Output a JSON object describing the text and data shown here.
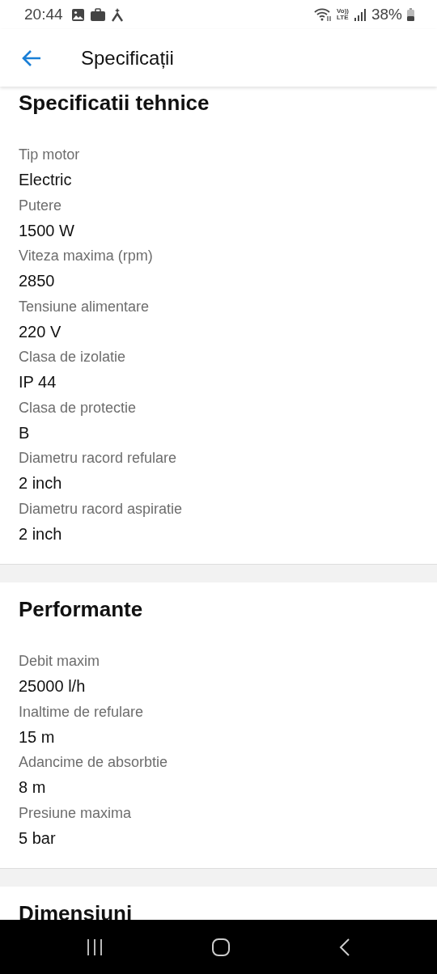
{
  "status_bar": {
    "time": "20:44",
    "network": "Vo)) LTE",
    "battery": "38%"
  },
  "app_bar": {
    "title": "Specificații"
  },
  "sections": [
    {
      "title": "Specificatii tehnice",
      "specs": [
        {
          "label": "Tip motor",
          "value": "Electric"
        },
        {
          "label": "Putere",
          "value": "1500 W"
        },
        {
          "label": "Viteza maxima (rpm)",
          "value": "2850"
        },
        {
          "label": "Tensiune alimentare",
          "value": "220 V"
        },
        {
          "label": "Clasa de izolatie",
          "value": "IP 44"
        },
        {
          "label": "Clasa de protectie",
          "value": "B"
        },
        {
          "label": "Diametru racord refulare",
          "value": "2 inch"
        },
        {
          "label": "Diametru racord aspiratie",
          "value": "2 inch"
        }
      ]
    },
    {
      "title": "Performante",
      "specs": [
        {
          "label": "Debit maxim",
          "value": "25000 l/h"
        },
        {
          "label": "Inaltime de refulare",
          "value": "15 m"
        },
        {
          "label": "Adancime de absorbtie",
          "value": "8 m"
        },
        {
          "label": "Presiune maxima",
          "value": "5 bar"
        }
      ]
    },
    {
      "title": "Dimensiuni"
    }
  ]
}
